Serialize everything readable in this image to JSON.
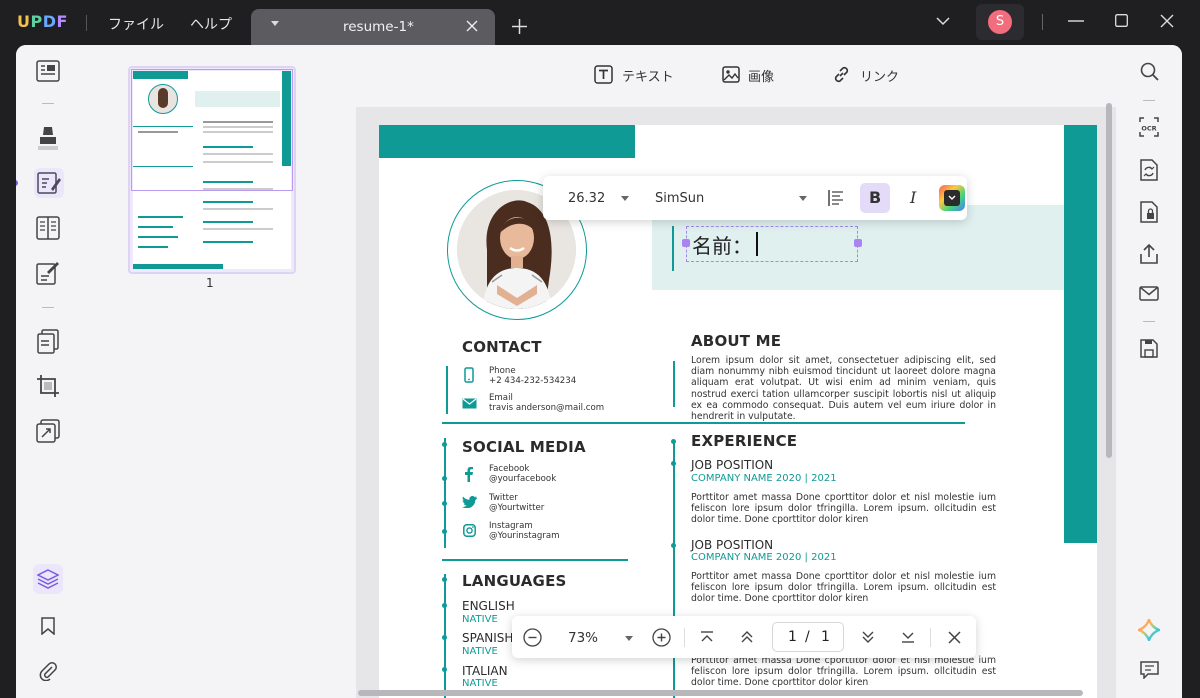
{
  "app": {
    "logo": "UPDF",
    "menu_file": "ファイル",
    "menu_help": "ヘルプ",
    "tab_title": "resume-1*",
    "avatar_letter": "S"
  },
  "edit_toolbar": {
    "text_label": "テキスト",
    "image_label": "画像",
    "link_label": "リンク"
  },
  "thumbnails": {
    "page_number": "1"
  },
  "font_toolbar": {
    "size": "26.32",
    "font": "SimSun",
    "bold": "B",
    "italic": "I"
  },
  "resume": {
    "name_text": "名前：",
    "contact": {
      "heading": "CONTACT",
      "phone_label": "Phone",
      "phone_value": "+2 434-232-534234",
      "email_label": "Email",
      "email_value": "travis anderson@mail.com"
    },
    "social": {
      "heading": "SOCIAL MEDIA",
      "facebook_label": "Facebook",
      "facebook_value": "@yourfacebook",
      "twitter_label": "Twitter",
      "twitter_value": "@Yourtwitter",
      "instagram_label": "Instagram",
      "instagram_value": "@Yourinstagram"
    },
    "languages": {
      "heading": "LANGUAGES",
      "items": [
        {
          "name": "ENGLISH",
          "level": "NATIVE"
        },
        {
          "name": "SPANISH",
          "level": "NATIVE"
        },
        {
          "name": "ITALIAN",
          "level": "NATIVE"
        }
      ]
    },
    "about": {
      "heading": "ABOUT ME",
      "text": "Lorem ipsum dolor sit amet, consectetuer adipiscing elit, sed diam nonummy nibh euismod tincidunt ut laoreet dolore magna aliquam erat volutpat. Ut wisi enim ad minim veniam, quis nostrud exerci tation ullamcorper suscipit lobortis nisl ut aliquip ex ea commodo consequat. Duis autem vel eum iriure dolor in hendrerit in vulputate."
    },
    "experience": {
      "heading": "EXPERIENCE",
      "jobs": [
        {
          "title": "JOB POSITION",
          "company": "COMPANY NAME 2020 | 2021",
          "text": "Porttitor amet massa Done cporttitor dolor et nisl molestie ium feliscon lore ipsum dolor tfringilla. Lorem ipsum. ollcitudin est dolor time. Done cporttitor dolor kiren"
        },
        {
          "title": "JOB POSITION",
          "company": "COMPANY NAME 2020 | 2021",
          "text": "Porttitor amet massa Done cporttitor dolor et nisl molestie ium feliscon lore ipsum dolor tfringilla. Lorem ipsum. ollcitudin est dolor time. Done cporttitor dolor kiren"
        },
        {
          "text": "Porttitor amet massa Done cporttitor dolor et nisl molestie ium feliscon lore ipsum dolor tfringilla. Lorem ipsum. ollcitudin est dolor time. Done cporttitor dolor kiren"
        }
      ]
    }
  },
  "zoom_bar": {
    "zoom": "73%",
    "current_page": "1",
    "separator": "/",
    "total_pages": "1"
  },
  "colors": {
    "teal": "#0f9a96",
    "light_teal": "#dff0ef",
    "accent_purple": "#8b5cf6",
    "title_bar": "#1f1f22"
  }
}
